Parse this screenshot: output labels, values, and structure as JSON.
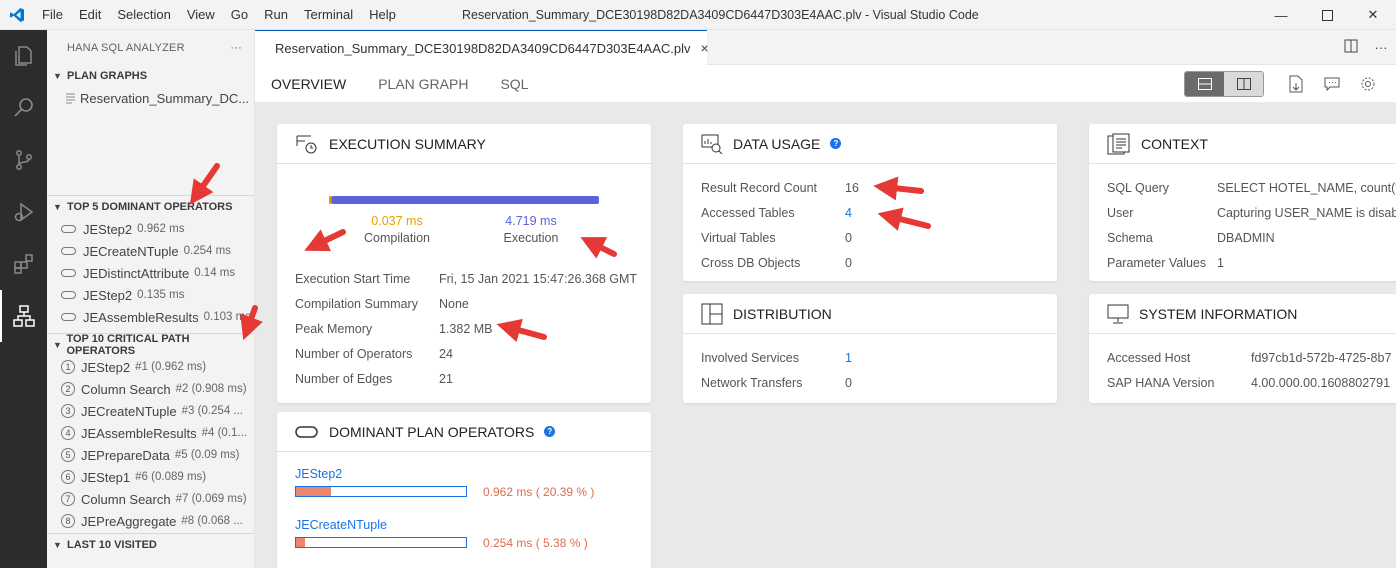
{
  "window": {
    "title": "Reservation_Summary_DCE30198D82DA3409CD6447D303E4AAC.plv - Visual Studio Code",
    "menu": [
      "File",
      "Edit",
      "Selection",
      "View",
      "Go",
      "Run",
      "Terminal",
      "Help"
    ]
  },
  "sidebar": {
    "title": "HANA SQL ANALYZER",
    "more": "···",
    "plan_graphs": {
      "label": "PLAN GRAPHS",
      "items": [
        "Reservation_Summary_DC..."
      ]
    },
    "top5": {
      "label": "TOP 5 DOMINANT OPERATORS",
      "items": [
        {
          "name": "JEStep2",
          "ms": "0.962 ms"
        },
        {
          "name": "JECreateNTuple",
          "ms": "0.254 ms"
        },
        {
          "name": "JEDistinctAttribute",
          "ms": "0.14 ms"
        },
        {
          "name": "JEStep2",
          "ms": "0.135 ms"
        },
        {
          "name": "JEAssembleResults",
          "ms": "0.103 ms"
        }
      ]
    },
    "top10": {
      "label": "TOP 10 CRITICAL PATH OPERATORS",
      "items": [
        {
          "n": "1",
          "name": "JEStep2",
          "detail": "#1 (0.962 ms)"
        },
        {
          "n": "2",
          "name": "Column Search",
          "detail": "#2 (0.908 ms)"
        },
        {
          "n": "3",
          "name": "JECreateNTuple",
          "detail": "#3 (0.254 ..."
        },
        {
          "n": "4",
          "name": "JEAssembleResults",
          "detail": "#4 (0.1..."
        },
        {
          "n": "5",
          "name": "JEPrepareData",
          "detail": "#5 (0.09 ms)"
        },
        {
          "n": "6",
          "name": "JEStep1",
          "detail": "#6 (0.089 ms)"
        },
        {
          "n": "7",
          "name": "Column Search",
          "detail": "#7 (0.069 ms)"
        },
        {
          "n": "8",
          "name": "JEPreAggregate",
          "detail": "#8 (0.068 ..."
        }
      ]
    },
    "last10": {
      "label": "LAST 10 VISITED"
    }
  },
  "editor": {
    "tab_label": "Reservation_Summary_DCE30198D82DA3409CD6447D303E4AAC.plv",
    "close": "×",
    "subtabs": [
      "OVERVIEW",
      "PLAN GRAPH",
      "SQL"
    ]
  },
  "execution_summary": {
    "title": "EXECUTION SUMMARY",
    "compilation_value": "0.037 ms",
    "compilation_label": "Compilation",
    "execution_value": "4.719 ms",
    "execution_label": "Execution",
    "compilation_fraction": 0.0078,
    "rows": [
      {
        "k": "Execution Start Time",
        "v": "Fri, 15 Jan 2021 15:47:26.368 GMT"
      },
      {
        "k": "Compilation Summary",
        "v": "None"
      },
      {
        "k": "Peak Memory",
        "v": "1.382 MB"
      },
      {
        "k": "Number of Operators",
        "v": "24"
      },
      {
        "k": "Number of Edges",
        "v": "21"
      }
    ]
  },
  "dominant": {
    "title": "DOMINANT PLAN OPERATORS",
    "items": [
      {
        "name": "JEStep2",
        "value": "0.962 ms ( 20.39 % )",
        "fraction": 0.2039
      },
      {
        "name": "JECreateNTuple",
        "value": "0.254 ms ( 5.38 % )",
        "fraction": 0.0538
      }
    ]
  },
  "data_usage": {
    "title": "DATA USAGE",
    "rows": [
      {
        "k": "Result Record Count",
        "v": "16"
      },
      {
        "k": "Accessed Tables",
        "v": "4"
      },
      {
        "k": "Virtual Tables",
        "v": "0"
      },
      {
        "k": "Cross DB Objects",
        "v": "0"
      }
    ]
  },
  "distribution": {
    "title": "DISTRIBUTION",
    "rows": [
      {
        "k": "Involved Services",
        "v": "1"
      },
      {
        "k": "Network Transfers",
        "v": "0"
      }
    ]
  },
  "context": {
    "title": "CONTEXT",
    "rows": [
      {
        "k": "SQL Query",
        "v": "SELECT HOTEL_NAME, count(*)"
      },
      {
        "k": "User",
        "v": "Capturing USER_NAME is disab"
      },
      {
        "k": "Schema",
        "v": "DBADMIN"
      },
      {
        "k": "Parameter Values",
        "v": "1"
      }
    ]
  },
  "system": {
    "title": "SYSTEM INFORMATION",
    "rows": [
      {
        "k": "Accessed Host",
        "v": "fd97cb1d-572b-4725-8b7"
      },
      {
        "k": "SAP HANA Version",
        "v": "4.00.000.00.1608802791"
      }
    ]
  },
  "colors": {
    "accent": "#005fb8",
    "compilation": "#e6a100",
    "execution": "#5b63d8",
    "bar_fill": "#e8866e",
    "link": "#1a73e8",
    "annotation_arrow": "#e53935"
  }
}
